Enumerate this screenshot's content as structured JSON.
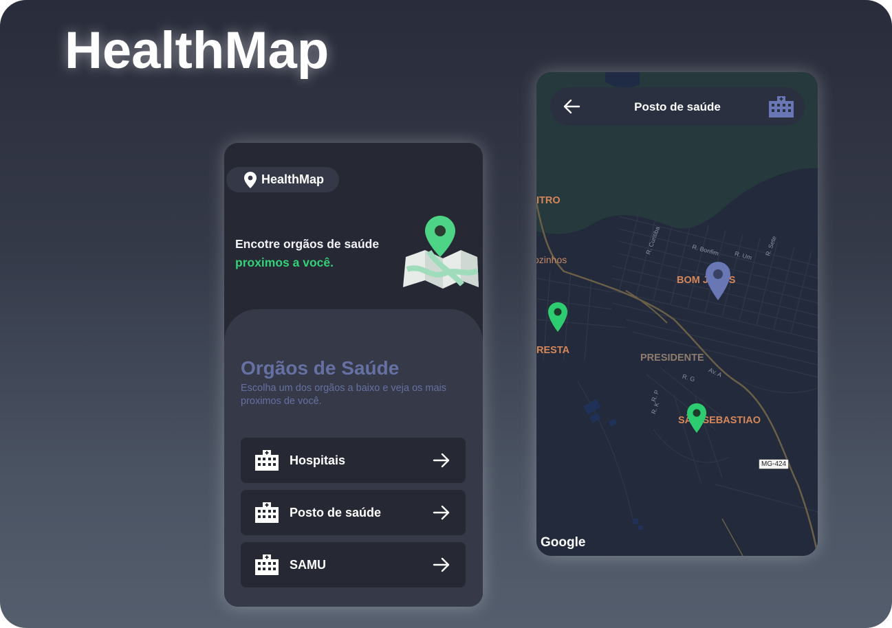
{
  "brand": {
    "hero_title": "HealthMap"
  },
  "home_screen": {
    "logo_label": "HealthMap",
    "headline_line1": "Encotre orgãos de saúde",
    "headline_line2": "proximos a você.",
    "section_title": "Orgãos de Saúde",
    "section_subtitle": "Escolha um dos orgãos a baixo e veja os mais proximos de você.",
    "items": [
      {
        "label": "Hospitais",
        "icon": "hospital-building-icon"
      },
      {
        "label": "Posto de saúde",
        "icon": "hospital-building-icon"
      },
      {
        "label": "SAMU",
        "icon": "hospital-building-icon"
      }
    ],
    "accent_color": "#34d178",
    "muted_color": "#6571a2"
  },
  "map_screen": {
    "title": "Posto de saúde",
    "places": {
      "centro": "ITRO",
      "pocinhos": "ozinhos",
      "bom_jesus": "BOM JESUS",
      "floresta": "RESTA",
      "presidente": "PRESIDENTE",
      "sao_sebastiao": "SÃO SEBASTIAO"
    },
    "roads": {
      "curitiba": "R. Curitiba",
      "bonfim": "R. Bonfim",
      "um": "R. Um",
      "sete": "R. Sete",
      "g": "R. G",
      "av_a": "Av. A",
      "r_p": "R. P",
      "r_k": "R. K"
    },
    "route_badge": "MG-424",
    "attribution": "Google",
    "marker_colors": {
      "green": "#2ecc71",
      "blue": "#6977b4"
    }
  }
}
